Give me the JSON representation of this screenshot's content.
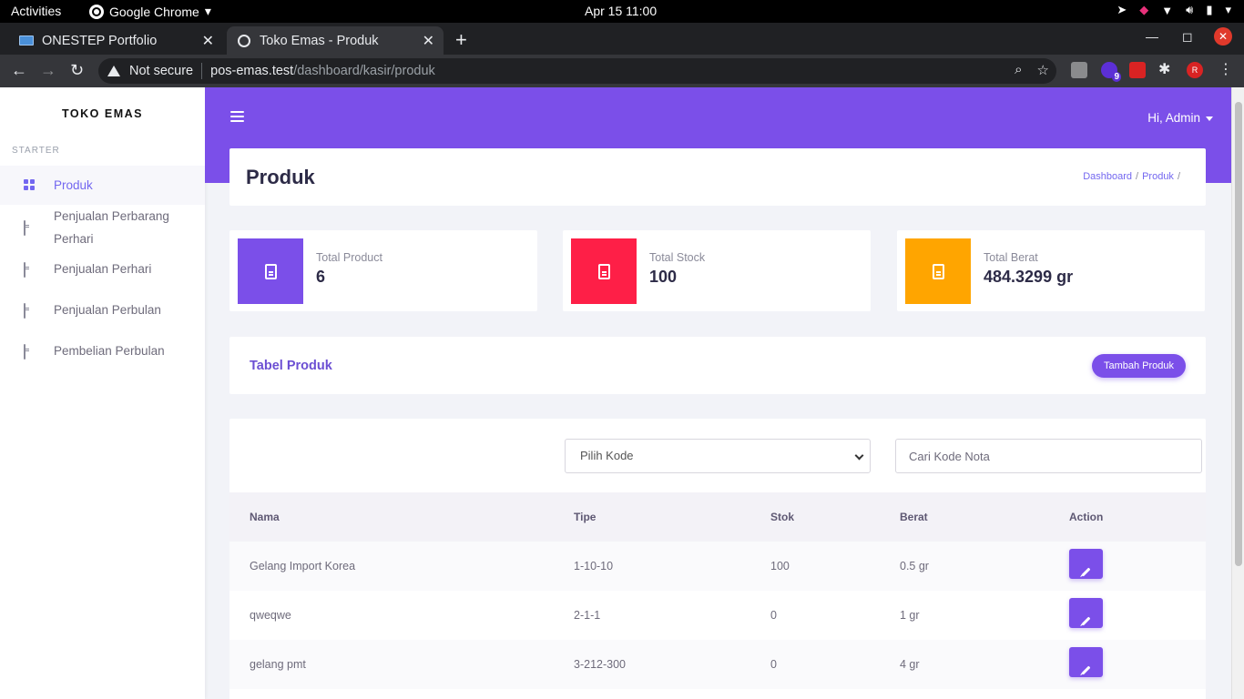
{
  "os_bar": {
    "activities": "Activities",
    "app_name": "Google Chrome",
    "clock": "Apr 15  11:00"
  },
  "browser": {
    "tabs": [
      {
        "title": "ONESTEP Portfolio",
        "close": "✕"
      },
      {
        "title": "Toko Emas - Produk",
        "close": "✕"
      }
    ],
    "new_tab": "+",
    "not_secure": "Not secure",
    "url_host": "pos-emas.test",
    "url_path": "/dashboard/kasir/produk",
    "ext_badge": "9",
    "profile_initial": "R"
  },
  "sidebar": {
    "brand": "TOKO EMAS",
    "section": "STARTER",
    "items": [
      {
        "label": "Produk"
      },
      {
        "label": "Penjualan Perbarang Perhari"
      },
      {
        "label": "Penjualan Perhari"
      },
      {
        "label": "Penjualan Perbulan"
      },
      {
        "label": "Pembelian Perbulan"
      }
    ]
  },
  "header": {
    "greeting": "Hi, Admin"
  },
  "page": {
    "title": "Produk",
    "breadcrumb": [
      "Dashboard",
      "Produk"
    ]
  },
  "stats": [
    {
      "label": "Total Product",
      "value": "6",
      "color": "#7b4fe9"
    },
    {
      "label": "Total Stock",
      "value": "100",
      "color": "#fe1f47"
    },
    {
      "label": "Total Berat",
      "value": "484.3299 gr",
      "color": "#ffa500"
    }
  ],
  "tabel": {
    "title": "Tabel Produk",
    "add_button": "Tambah Produk",
    "select_value": "Pilih Kode",
    "search_placeholder": "Cari Kode Nota",
    "columns": [
      "Nama",
      "Tipe",
      "Stok",
      "Berat",
      "Action"
    ],
    "rows": [
      {
        "nama": "Gelang Import Korea",
        "tipe": "1-10-10",
        "stok": "100",
        "berat": "0.5 gr"
      },
      {
        "nama": "qweqwe",
        "tipe": "2-1-1",
        "stok": "0",
        "berat": "1 gr"
      },
      {
        "nama": "gelang pmt",
        "tipe": "3-212-300",
        "stok": "0",
        "berat": "4 gr"
      }
    ]
  },
  "colors": {
    "accent": "#7b4fe9",
    "danger": "#fe1f47",
    "warning": "#ffa500"
  }
}
